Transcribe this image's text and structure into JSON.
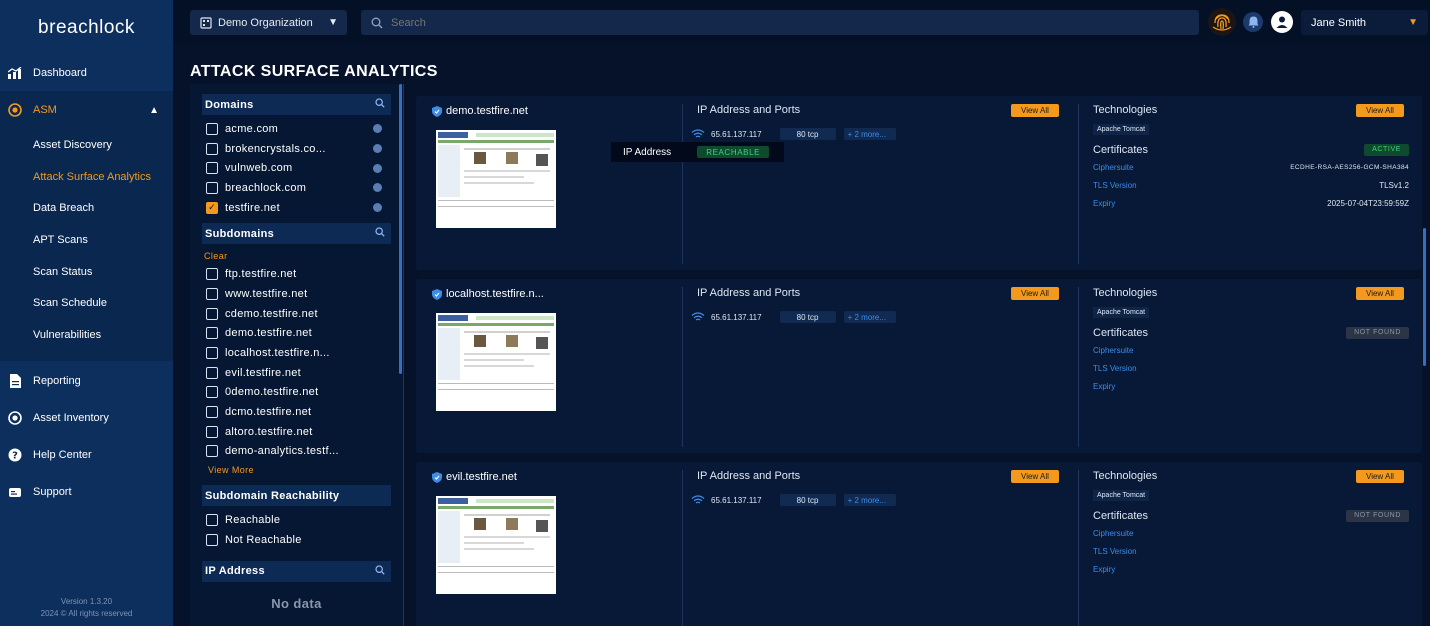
{
  "brand": {
    "logo_text": "breachlock"
  },
  "sidebar": {
    "items_top": [
      {
        "label": "Dashboard",
        "icon": "chart-icon"
      }
    ],
    "asm": {
      "label": "ASM",
      "sub_items": [
        {
          "label": "Asset Discovery"
        },
        {
          "label": "Attack Surface Analytics"
        },
        {
          "label": "Data Breach"
        },
        {
          "label": "APT Scans"
        },
        {
          "label": "Scan Status"
        },
        {
          "label": "Scan Schedule"
        },
        {
          "label": "Vulnerabilities"
        }
      ]
    },
    "items_bottom": [
      {
        "label": "Reporting"
      },
      {
        "label": "Asset Inventory"
      },
      {
        "label": "Help Center"
      },
      {
        "label": "Support"
      }
    ],
    "version": "Version 1.3.20",
    "copyright": "2024 © All rights reserved"
  },
  "topbar": {
    "org": "Demo Organization",
    "search_placeholder": "Search",
    "user": "Jane Smith"
  },
  "page": {
    "title": "ATTACK SURFACE ANALYTICS"
  },
  "filters": {
    "domains": {
      "title": "Domains",
      "options": [
        {
          "label": "acme.com",
          "checked": false
        },
        {
          "label": "brokencrystals.co...",
          "checked": false
        },
        {
          "label": "vulnweb.com",
          "checked": false
        },
        {
          "label": "breachlock.com",
          "checked": false
        },
        {
          "label": "testfire.net",
          "checked": true
        }
      ]
    },
    "subdomains": {
      "title": "Subdomains",
      "clear": "Clear",
      "options": [
        "ftp.testfire.net",
        "www.testfire.net",
        "cdemo.testfire.net",
        "demo.testfire.net",
        "localhost.testfire.n...",
        "evil.testfire.net",
        "0demo.testfire.net",
        "dcmo.testfire.net",
        "altoro.testfire.net",
        "demo-analytics.testf..."
      ],
      "view_more": "View More"
    },
    "reachability": {
      "title": "Subdomain Reachability",
      "options": [
        "Reachable",
        "Not Reachable"
      ]
    },
    "ip": {
      "title": "IP Address",
      "empty": "No data"
    }
  },
  "cards": [
    {
      "domain": "demo.testfire.net",
      "ip_header": "IP Address and Ports",
      "ip": "65.61.137.117",
      "port": "80 tcp",
      "more": "+ 2  more...",
      "view_all": "View All",
      "tech_header": "Technologies",
      "tech": "Apache Tomcat",
      "cert_header": "Certificates",
      "cert_status": "ACTIVE",
      "ciphersuite_label": "Ciphersuite",
      "ciphersuite_value": "ECDHE-RSA-AES256-GCM-SHA384",
      "tls_label": "TLS Version",
      "tls_value": "TLSv1.2",
      "expiry_label": "Expiry",
      "expiry_value": "2025-07-04T23:59:59Z"
    },
    {
      "domain": "localhost.testfire.n...",
      "ip_header": "IP Address and Ports",
      "ip": "65.61.137.117",
      "port": "80 tcp",
      "more": "+ 2  more...",
      "view_all": "View All",
      "tech_header": "Technologies",
      "tech": "Apache Tomcat",
      "cert_header": "Certificates",
      "cert_status": "NOT FOUND",
      "ciphersuite_label": "Ciphersuite",
      "ciphersuite_value": "",
      "tls_label": "TLS Version",
      "tls_value": "",
      "expiry_label": "Expiry",
      "expiry_value": ""
    },
    {
      "domain": "evil.testfire.net",
      "ip_header": "IP Address and Ports",
      "ip": "65.61.137.117",
      "port": "80 tcp",
      "more": "+ 2  more...",
      "view_all": "View All",
      "tech_header": "Technologies",
      "tech": "Apache Tomcat",
      "cert_header": "Certificates",
      "cert_status": "NOT FOUND",
      "ciphersuite_label": "Ciphersuite",
      "ciphersuite_value": "",
      "tls_label": "TLS Version",
      "tls_value": "",
      "expiry_label": "Expiry",
      "expiry_value": ""
    }
  ],
  "tooltip": {
    "label": "IP Address",
    "status": "REACHABLE"
  },
  "colors": {
    "accent": "#f39a1e",
    "sidebar": "#0d2f5e",
    "background": "#06122a",
    "link": "#3f8be8",
    "success": "#3fd27a"
  }
}
